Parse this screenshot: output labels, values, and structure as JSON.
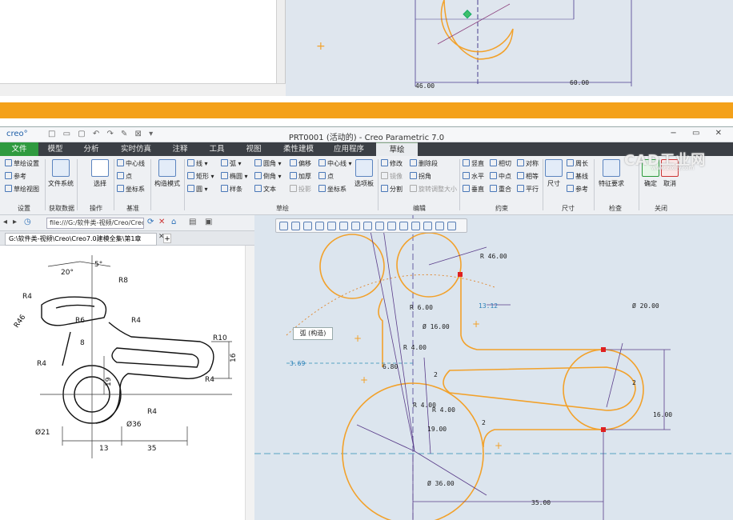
{
  "top_dims": {
    "d1": "46.00",
    "d2": "60.00"
  },
  "window": {
    "logo": "creo°",
    "title": "PRT0001 (活动的) - Creo Parametric 7.0"
  },
  "tabs": [
    "文件",
    "模型",
    "分析",
    "实时仿真",
    "注释",
    "工具",
    "视图",
    "柔性建模",
    "应用程序",
    "草绘"
  ],
  "ribbon": {
    "setup": {
      "items": [
        "草绘设置",
        "参考",
        "草绘视图"
      ],
      "group": "设置"
    },
    "getdata": {
      "label": "文件系统",
      "group": "获取数据"
    },
    "operations": {
      "select": "选择",
      "group": "操作"
    },
    "datum": {
      "items": [
        "中心线",
        "点",
        "坐标系"
      ],
      "group": "基准"
    },
    "construction": "构造模式",
    "sketch": {
      "col1": [
        "线",
        "矩形",
        "圆"
      ],
      "col2": [
        "弧",
        "椭圆",
        "样条"
      ],
      "col3": [
        "圆角",
        "倒角",
        "文本"
      ],
      "col4": [
        "偏移",
        "加厚",
        "投影"
      ],
      "col5": [
        "中心线",
        "点",
        "坐标系"
      ],
      "palette": "选项板",
      "group": "草绘"
    },
    "editing": {
      "items": [
        "修改",
        "删除段",
        "镜像",
        "拐角",
        "分割",
        "旋转调整大小"
      ],
      "group": "编辑"
    },
    "constrain": {
      "items": [
        "竖直",
        "相切",
        "对称",
        "水平",
        "中点",
        "相等",
        "垂直",
        "重合",
        "平行"
      ],
      "group": "约束"
    },
    "dimension": {
      "items": [
        "尺寸",
        "周长",
        "基线",
        "参考"
      ],
      "group": "尺寸"
    },
    "inspect": {
      "label": "特征要求",
      "group": "检查"
    },
    "close": {
      "ok": "确定",
      "cancel": "取消",
      "group": "关闭"
    }
  },
  "browser": {
    "url": "file:///G:/软件类-视频/Creo/Creo",
    "tab": "G:\\软件类-视频\\Creo\\Creo7.0建模全集\\第1章"
  },
  "ref_drawing": {
    "labels": [
      "20°",
      "5°",
      "R8",
      "R4",
      "R6",
      "R4",
      "R46",
      "8",
      "R10",
      "R4",
      "19",
      "16",
      "R4",
      "Ø21",
      "Ø36",
      "R4",
      "13",
      "35"
    ]
  },
  "sketch_dims": {
    "r46": "R 46.00",
    "d1312": "13.12",
    "d20": "Ø 20.00",
    "r6": "R 6.00",
    "d16a": "Ø 16.00",
    "r4a": "R 4.00",
    "d369": "3.69",
    "d680": "6.80",
    "r4b": "R 4.00",
    "r4c": "R 4.00",
    "d19": "19.00",
    "d16b": "16.00",
    "d36": "Ø 36.00",
    "d35": "35.00",
    "two1": "2",
    "two2": "2",
    "two3": "2"
  },
  "tooltip": "弧 (构造)",
  "watermark": {
    "main": "CAD工业网",
    "sub": "www.zixuy.com"
  }
}
